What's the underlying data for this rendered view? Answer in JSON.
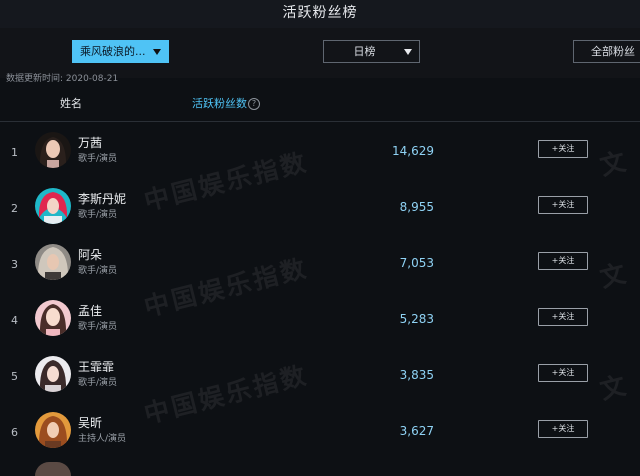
{
  "header": {
    "title": "活跃粉丝榜"
  },
  "filters": {
    "show": {
      "label": "乘风破浪的..."
    },
    "range": {
      "label": "日榜"
    },
    "fans_type": {
      "label": "全部粉丝"
    }
  },
  "meta": {
    "updated": "数据更新时间: 2020-08-21"
  },
  "columns": {
    "name": "姓名",
    "fans": "活跃粉丝数",
    "help": "?"
  },
  "follow_label": "+关注",
  "watermark": {
    "text": "中国娱乐指数",
    "text2": "文 漫 娱"
  },
  "rows": [
    {
      "rank": "1",
      "name": "万茜",
      "role": "歌手/演员",
      "count": "14,629"
    },
    {
      "rank": "2",
      "name": "李斯丹妮",
      "role": "歌手/演员",
      "count": "8,955"
    },
    {
      "rank": "3",
      "name": "阿朵",
      "role": "歌手/演员",
      "count": "7,053"
    },
    {
      "rank": "4",
      "name": "孟佳",
      "role": "歌手/演员",
      "count": "5,283"
    },
    {
      "rank": "5",
      "name": "王霏霏",
      "role": "歌手/演员",
      "count": "3,835"
    },
    {
      "rank": "6",
      "name": "吴昕",
      "role": "主持人/演员",
      "count": "3,627"
    }
  ],
  "colors": {
    "accent": "#4fc3f5",
    "background": "#0d1014",
    "count": "#8fd2f4"
  }
}
